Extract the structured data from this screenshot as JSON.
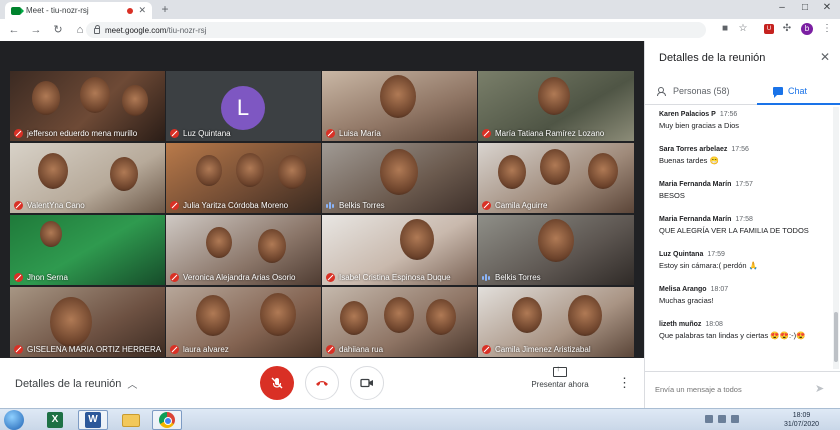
{
  "browser": {
    "tab_title": "Meet - tiu-nozr-rsj",
    "new_tab_label": "+",
    "url_host": "meet.google.com",
    "url_path": "/tiu-nozr-rsj",
    "window_controls": [
      "–",
      "□",
      "✕"
    ],
    "profile_initial": "b"
  },
  "participants": [
    {
      "name": "jefferson eduerdo mena murillo",
      "muted": true
    },
    {
      "name": "Luz Quintana",
      "muted": true,
      "avatar_letter": "L"
    },
    {
      "name": "Luisa María",
      "muted": true
    },
    {
      "name": "María Tatiana Ramírez Lozano",
      "muted": true
    },
    {
      "name": "ValentYna Cano",
      "muted": true
    },
    {
      "name": "Julia Yaritza Córdoba Moreno",
      "muted": true
    },
    {
      "name": "Belkis Torres",
      "muted": false,
      "speaking": true
    },
    {
      "name": "Camila Aguirre",
      "muted": true
    },
    {
      "name": "Jhon Serna",
      "muted": true
    },
    {
      "name": "Veronica Alejandra Arias Osorio",
      "muted": true
    },
    {
      "name": "Isabel Cristina Espinosa Duque",
      "muted": true
    },
    {
      "name": "Belkis Torres",
      "muted": false,
      "speaking": true
    },
    {
      "name": "GISELENA MARIA ORTIZ HERRERA",
      "muted": true
    },
    {
      "name": "laura alvarez",
      "muted": true
    },
    {
      "name": "dahiiana rua",
      "muted": true
    },
    {
      "name": "Camila Jimenez Aristizabal",
      "muted": true
    }
  ],
  "controls": {
    "meeting_details": "Detalles de la reunión",
    "present_label": "Presentar ahora"
  },
  "panel": {
    "title": "Detalles de la reunión",
    "people_tab": "Personas (58)",
    "chat_tab": "Chat",
    "compose_placeholder": "Envía un mensaje a todos",
    "messages": [
      {
        "sender": "Karen Palacios P",
        "time": "17:56",
        "text": "Muy bien gracias a Dios"
      },
      {
        "sender": "Sara Torres arbelaez",
        "time": "17:56",
        "text": "Buenas tardes 😁"
      },
      {
        "sender": "Maria Fernanda Marín",
        "time": "17:57",
        "text": "BESOS"
      },
      {
        "sender": "Maria Fernanda Marín",
        "time": "17:58",
        "text": "QUE ALEGRÍA VER LA FAMILIA DE TODOS"
      },
      {
        "sender": "Luz Quintana",
        "time": "17:59",
        "text": "Estoy sin cámara:( perdón 🙏"
      },
      {
        "sender": "Melisa Arango",
        "time": "18:07",
        "text": "Muchas gracias!"
      },
      {
        "sender": "lizeth muñoz",
        "time": "18:08",
        "text": "Que palabras tan lindas y ciertas 😍😍:-)😍"
      }
    ]
  },
  "taskbar": {
    "clock_time": "18:09",
    "clock_date": "31/07/2020",
    "apps": [
      "excel",
      "word",
      "explorer",
      "chrome"
    ]
  },
  "colors": {
    "meet_bg": "#202124",
    "muted_red": "#d93025",
    "accent_blue": "#1a73e8",
    "avatar_purple": "#7e57c2"
  }
}
